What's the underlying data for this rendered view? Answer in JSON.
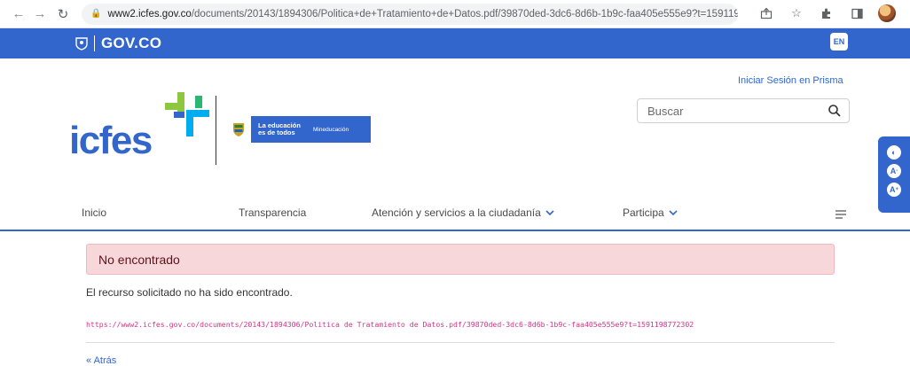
{
  "browser": {
    "url_host": "www2.icfes.gov.co",
    "url_path": "/documents/20143/1894306/Politica+de+Tratamiento+de+Datos.pdf/39870ded-3dc6-8d6b-1b9c-faa405e555e9?t=1591198772302"
  },
  "govbar": {
    "logo_text": "GOV.CO",
    "lang_button": "EN",
    "color": "#3366cc"
  },
  "header": {
    "login_link": "Iniciar Sesión en Prisma",
    "search_placeholder": "Buscar",
    "logo_text": "icfes",
    "edu_slogan_line1": "La educación",
    "edu_slogan_line2": "es de todos",
    "edu_ministry": "Mineducación"
  },
  "accessibility": {
    "contrast_icon": "contrast-icon",
    "decrease_label": "A-",
    "increase_label": "A+"
  },
  "menu": {
    "items": [
      {
        "label": "Inicio",
        "has_dropdown": false
      },
      {
        "label": "Transparencia",
        "has_dropdown": false
      },
      {
        "label": "Atención y servicios a la ciudadanía",
        "has_dropdown": true
      },
      {
        "label": "Participa",
        "has_dropdown": true
      }
    ]
  },
  "content": {
    "alert_title": "No encontrado",
    "message": "El recurso solicitado no ha sido encontrado.",
    "requested_url": "https://www2.icfes.gov.co/documents/20143/1894306/Politica de Tratamiento de Datos.pdf/39870ded-3dc6-8d6b-1b9c-faa405e555e9?t=1591198772302",
    "back_link": "« Atrás"
  }
}
